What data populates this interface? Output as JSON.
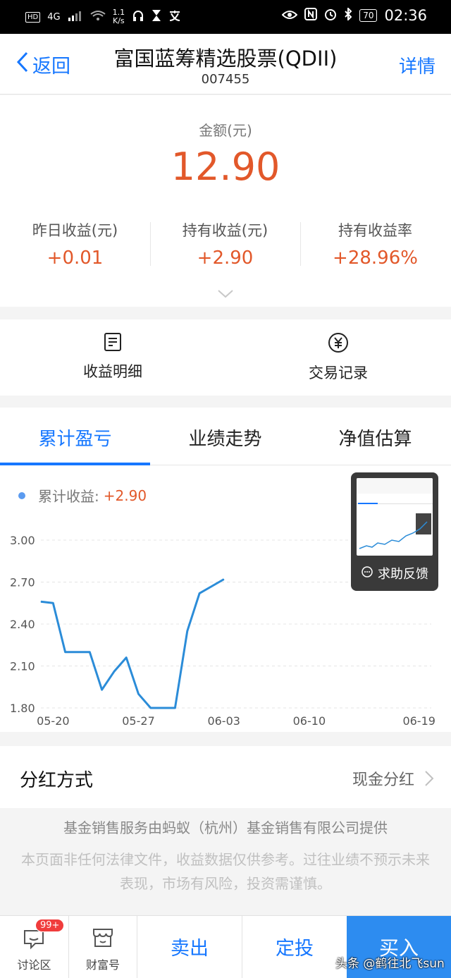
{
  "status_bar": {
    "net_type": "4G",
    "speed_value": "1.1",
    "speed_unit": "K/s",
    "battery": "70",
    "time": "02:36"
  },
  "nav": {
    "back_label": "返回",
    "title": "富国蓝筹精选股票(QDII)",
    "code": "007455",
    "detail_label": "详情"
  },
  "summary": {
    "amount_label": "金额(元)",
    "amount_value": "12.90",
    "stats": [
      {
        "label": "昨日收益(元)",
        "value": "+0.01"
      },
      {
        "label": "持有收益(元)",
        "value": "+2.90"
      },
      {
        "label": "持有收益率",
        "value": "+28.96%"
      }
    ]
  },
  "actions": [
    {
      "label": "收益明细",
      "icon": "document-icon"
    },
    {
      "label": "交易记录",
      "icon": "yen-circle-icon"
    }
  ],
  "tabs": [
    {
      "label": "累计盈亏",
      "active": true
    },
    {
      "label": "业绩走势",
      "active": false
    },
    {
      "label": "净值估算",
      "active": false
    }
  ],
  "legend": {
    "label": "累计收益:",
    "value": "+2.90"
  },
  "chart_data": {
    "type": "line",
    "x": [
      "05-19",
      "05-20",
      "05-21",
      "05-22",
      "05-23",
      "05-24",
      "05-25",
      "05-26",
      "05-27",
      "05-28",
      "05-29",
      "05-30",
      "05-31",
      "06-01",
      "06-02",
      "06-03"
    ],
    "y": [
      2.56,
      2.55,
      2.2,
      2.2,
      2.2,
      1.93,
      2.06,
      2.16,
      1.9,
      1.8,
      1.8,
      1.8,
      2.35,
      2.62,
      2.67,
      2.72
    ],
    "series": [
      {
        "name": "累计收益",
        "values": [
          2.56,
          2.55,
          2.2,
          2.2,
          2.2,
          1.93,
          2.06,
          2.16,
          1.9,
          1.8,
          1.8,
          1.8,
          2.35,
          2.62,
          2.67,
          2.72
        ]
      }
    ],
    "y_ticks": [
      "3.00",
      "2.70",
      "2.40",
      "2.10",
      "1.80"
    ],
    "x_ticks": [
      "05-20",
      "05-27",
      "06-03",
      "06-10",
      "06-19"
    ],
    "x_range": [
      "05-19",
      "06-20"
    ],
    "ylim": [
      1.8,
      3.0
    ],
    "grid": true,
    "line_color": "#2b8cd8"
  },
  "help": {
    "label": "求助反馈"
  },
  "dividend": {
    "label": "分红方式",
    "value": "现金分红"
  },
  "disclaimer": {
    "provider": "基金销售服务由蚂蚁（杭州）基金销售有限公司提供",
    "notice": "本页面非任何法律文件，收益数据仅供参考。过往业绩不预示未来表现，市场有风险，投资需谨慎。"
  },
  "bottom_bar": {
    "discuss_label": "讨论区",
    "discuss_badge": "99+",
    "wealth_label": "财富号",
    "sell_label": "卖出",
    "auto_label": "定投",
    "buy_label": "买入"
  },
  "watermark": "头条 @鹤往北飞sun",
  "colors": {
    "accent": "#1677ff",
    "gain": "#e2582a",
    "buy_bg": "#2d8cf0"
  }
}
